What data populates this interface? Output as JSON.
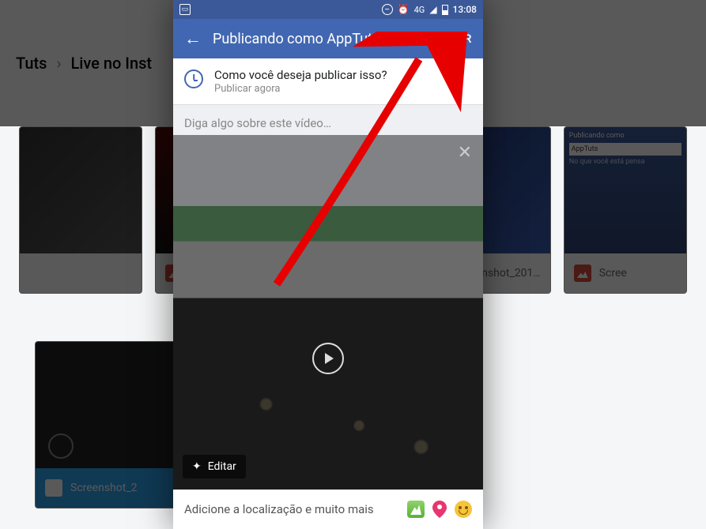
{
  "background": {
    "breadcrumb": {
      "part1": "Tuts",
      "part2": "Live no Inst"
    },
    "card_labels": {
      "c1": "Screenshot_2",
      "c2": "creenshot_201…",
      "c3": "Scree",
      "c4": "Screenshot_2"
    },
    "fb_thumb": {
      "title": "Publicando como",
      "user": "AppTuts",
      "hint": "No que você está pensa"
    }
  },
  "statusbar": {
    "network": "4G",
    "time": "13:08"
  },
  "appbar": {
    "title": "Publicando como AppTuts",
    "publish": "PUBLICAR"
  },
  "schedule": {
    "question": "Como você deseja publicar isso?",
    "answer": "Publicar agora"
  },
  "caption_placeholder": "Diga algo sobre este vídeo…",
  "edit_label": "Editar",
  "location": {
    "text": "Adicione a localização e muito mais"
  }
}
